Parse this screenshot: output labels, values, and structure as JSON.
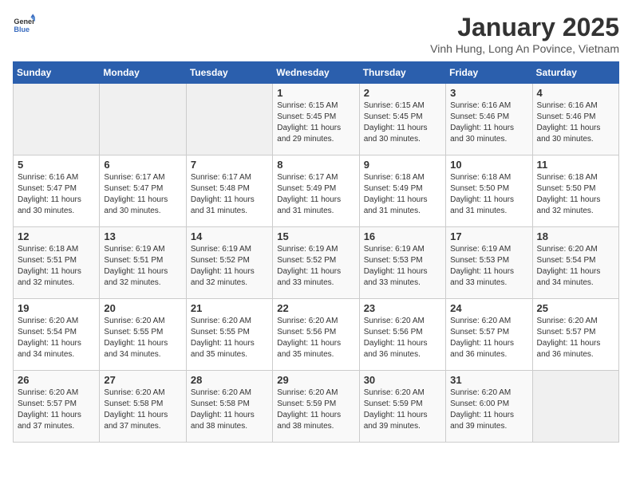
{
  "header": {
    "logo_general": "General",
    "logo_blue": "Blue",
    "month_title": "January 2025",
    "subtitle": "Vinh Hung, Long An Povince, Vietnam"
  },
  "days_of_week": [
    "Sunday",
    "Monday",
    "Tuesday",
    "Wednesday",
    "Thursday",
    "Friday",
    "Saturday"
  ],
  "weeks": [
    [
      {
        "day": "",
        "info": ""
      },
      {
        "day": "",
        "info": ""
      },
      {
        "day": "",
        "info": ""
      },
      {
        "day": "1",
        "info": "Sunrise: 6:15 AM\nSunset: 5:45 PM\nDaylight: 11 hours\nand 29 minutes."
      },
      {
        "day": "2",
        "info": "Sunrise: 6:15 AM\nSunset: 5:45 PM\nDaylight: 11 hours\nand 30 minutes."
      },
      {
        "day": "3",
        "info": "Sunrise: 6:16 AM\nSunset: 5:46 PM\nDaylight: 11 hours\nand 30 minutes."
      },
      {
        "day": "4",
        "info": "Sunrise: 6:16 AM\nSunset: 5:46 PM\nDaylight: 11 hours\nand 30 minutes."
      }
    ],
    [
      {
        "day": "5",
        "info": "Sunrise: 6:16 AM\nSunset: 5:47 PM\nDaylight: 11 hours\nand 30 minutes."
      },
      {
        "day": "6",
        "info": "Sunrise: 6:17 AM\nSunset: 5:47 PM\nDaylight: 11 hours\nand 30 minutes."
      },
      {
        "day": "7",
        "info": "Sunrise: 6:17 AM\nSunset: 5:48 PM\nDaylight: 11 hours\nand 31 minutes."
      },
      {
        "day": "8",
        "info": "Sunrise: 6:17 AM\nSunset: 5:49 PM\nDaylight: 11 hours\nand 31 minutes."
      },
      {
        "day": "9",
        "info": "Sunrise: 6:18 AM\nSunset: 5:49 PM\nDaylight: 11 hours\nand 31 minutes."
      },
      {
        "day": "10",
        "info": "Sunrise: 6:18 AM\nSunset: 5:50 PM\nDaylight: 11 hours\nand 31 minutes."
      },
      {
        "day": "11",
        "info": "Sunrise: 6:18 AM\nSunset: 5:50 PM\nDaylight: 11 hours\nand 32 minutes."
      }
    ],
    [
      {
        "day": "12",
        "info": "Sunrise: 6:18 AM\nSunset: 5:51 PM\nDaylight: 11 hours\nand 32 minutes."
      },
      {
        "day": "13",
        "info": "Sunrise: 6:19 AM\nSunset: 5:51 PM\nDaylight: 11 hours\nand 32 minutes."
      },
      {
        "day": "14",
        "info": "Sunrise: 6:19 AM\nSunset: 5:52 PM\nDaylight: 11 hours\nand 32 minutes."
      },
      {
        "day": "15",
        "info": "Sunrise: 6:19 AM\nSunset: 5:52 PM\nDaylight: 11 hours\nand 33 minutes."
      },
      {
        "day": "16",
        "info": "Sunrise: 6:19 AM\nSunset: 5:53 PM\nDaylight: 11 hours\nand 33 minutes."
      },
      {
        "day": "17",
        "info": "Sunrise: 6:19 AM\nSunset: 5:53 PM\nDaylight: 11 hours\nand 33 minutes."
      },
      {
        "day": "18",
        "info": "Sunrise: 6:20 AM\nSunset: 5:54 PM\nDaylight: 11 hours\nand 34 minutes."
      }
    ],
    [
      {
        "day": "19",
        "info": "Sunrise: 6:20 AM\nSunset: 5:54 PM\nDaylight: 11 hours\nand 34 minutes."
      },
      {
        "day": "20",
        "info": "Sunrise: 6:20 AM\nSunset: 5:55 PM\nDaylight: 11 hours\nand 34 minutes."
      },
      {
        "day": "21",
        "info": "Sunrise: 6:20 AM\nSunset: 5:55 PM\nDaylight: 11 hours\nand 35 minutes."
      },
      {
        "day": "22",
        "info": "Sunrise: 6:20 AM\nSunset: 5:56 PM\nDaylight: 11 hours\nand 35 minutes."
      },
      {
        "day": "23",
        "info": "Sunrise: 6:20 AM\nSunset: 5:56 PM\nDaylight: 11 hours\nand 36 minutes."
      },
      {
        "day": "24",
        "info": "Sunrise: 6:20 AM\nSunset: 5:57 PM\nDaylight: 11 hours\nand 36 minutes."
      },
      {
        "day": "25",
        "info": "Sunrise: 6:20 AM\nSunset: 5:57 PM\nDaylight: 11 hours\nand 36 minutes."
      }
    ],
    [
      {
        "day": "26",
        "info": "Sunrise: 6:20 AM\nSunset: 5:57 PM\nDaylight: 11 hours\nand 37 minutes."
      },
      {
        "day": "27",
        "info": "Sunrise: 6:20 AM\nSunset: 5:58 PM\nDaylight: 11 hours\nand 37 minutes."
      },
      {
        "day": "28",
        "info": "Sunrise: 6:20 AM\nSunset: 5:58 PM\nDaylight: 11 hours\nand 38 minutes."
      },
      {
        "day": "29",
        "info": "Sunrise: 6:20 AM\nSunset: 5:59 PM\nDaylight: 11 hours\nand 38 minutes."
      },
      {
        "day": "30",
        "info": "Sunrise: 6:20 AM\nSunset: 5:59 PM\nDaylight: 11 hours\nand 39 minutes."
      },
      {
        "day": "31",
        "info": "Sunrise: 6:20 AM\nSunset: 6:00 PM\nDaylight: 11 hours\nand 39 minutes."
      },
      {
        "day": "",
        "info": ""
      }
    ]
  ]
}
